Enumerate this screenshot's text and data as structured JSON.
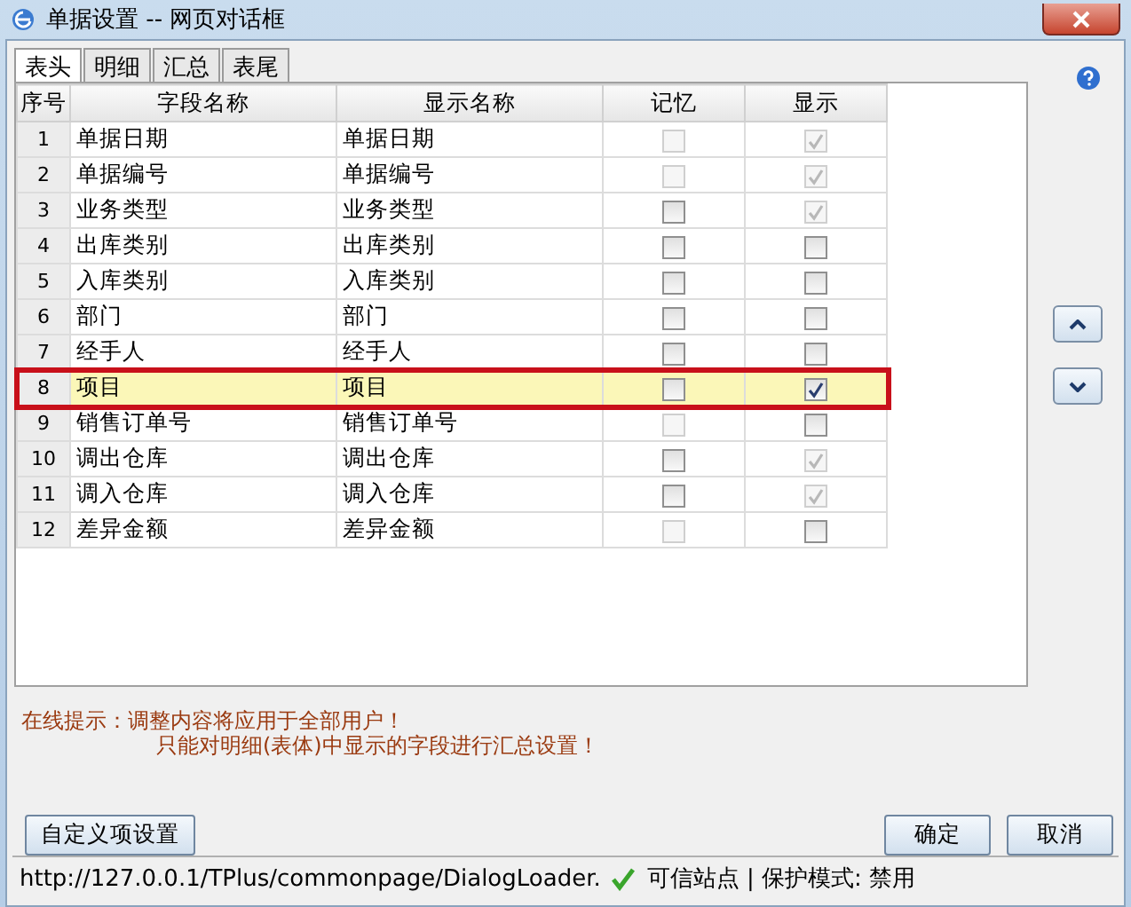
{
  "window": {
    "title": "单据设置 -- 网页对话框"
  },
  "tabs": [
    {
      "label": "表头",
      "selected": true
    },
    {
      "label": "明细",
      "selected": false
    },
    {
      "label": "汇总",
      "selected": false
    },
    {
      "label": "表尾",
      "selected": false
    }
  ],
  "table": {
    "columns": [
      "序号",
      "字段名称",
      "显示名称",
      "记忆",
      "显示"
    ],
    "rows": [
      {
        "no": "1",
        "field": "单据日期",
        "display": "单据日期",
        "selected": false,
        "outlined": false,
        "remember": {
          "checked": false,
          "disabled": true
        },
        "show": {
          "checked": true,
          "disabled": true
        }
      },
      {
        "no": "2",
        "field": "单据编号",
        "display": "单据编号",
        "selected": false,
        "outlined": false,
        "remember": {
          "checked": false,
          "disabled": true
        },
        "show": {
          "checked": true,
          "disabled": true
        }
      },
      {
        "no": "3",
        "field": "业务类型",
        "display": "业务类型",
        "selected": false,
        "outlined": false,
        "remember": {
          "checked": false,
          "disabled": false
        },
        "show": {
          "checked": true,
          "disabled": true
        }
      },
      {
        "no": "4",
        "field": "出库类别",
        "display": "出库类别",
        "selected": false,
        "outlined": false,
        "remember": {
          "checked": false,
          "disabled": false
        },
        "show": {
          "checked": false,
          "disabled": false
        }
      },
      {
        "no": "5",
        "field": "入库类别",
        "display": "入库类别",
        "selected": false,
        "outlined": false,
        "remember": {
          "checked": false,
          "disabled": false
        },
        "show": {
          "checked": false,
          "disabled": false
        }
      },
      {
        "no": "6",
        "field": "部门",
        "display": "部门",
        "selected": false,
        "outlined": false,
        "remember": {
          "checked": false,
          "disabled": false
        },
        "show": {
          "checked": false,
          "disabled": false
        }
      },
      {
        "no": "7",
        "field": "经手人",
        "display": "经手人",
        "selected": false,
        "outlined": false,
        "remember": {
          "checked": false,
          "disabled": false
        },
        "show": {
          "checked": false,
          "disabled": false
        }
      },
      {
        "no": "8",
        "field": "项目",
        "display": "项目",
        "selected": true,
        "outlined": true,
        "remember": {
          "checked": false,
          "disabled": false
        },
        "show": {
          "checked": true,
          "disabled": false
        }
      },
      {
        "no": "9",
        "field": "销售订单号",
        "display": "销售订单号",
        "selected": false,
        "outlined": false,
        "remember": {
          "checked": false,
          "disabled": true
        },
        "show": {
          "checked": false,
          "disabled": false
        }
      },
      {
        "no": "10",
        "field": "调出仓库",
        "display": "调出仓库",
        "selected": false,
        "outlined": false,
        "remember": {
          "checked": false,
          "disabled": false
        },
        "show": {
          "checked": true,
          "disabled": true
        }
      },
      {
        "no": "11",
        "field": "调入仓库",
        "display": "调入仓库",
        "selected": false,
        "outlined": false,
        "remember": {
          "checked": false,
          "disabled": false
        },
        "show": {
          "checked": true,
          "disabled": true
        }
      },
      {
        "no": "12",
        "field": "差异金额",
        "display": "差异金额",
        "selected": false,
        "outlined": false,
        "remember": {
          "checked": false,
          "disabled": true
        },
        "show": {
          "checked": false,
          "disabled": false
        }
      }
    ]
  },
  "tips": [
    "在线提示：调整内容将应用于全部用户！",
    "只能对明细(表体)中显示的字段进行汇总设置！"
  ],
  "buttons": {
    "custom": "自定义项设置",
    "ok": "确定",
    "cancel": "取消"
  },
  "status_bar": {
    "url": "http://127.0.0.1/TPlus/commonpage/DialogLoader.",
    "zone": "可信站点 | 保护模式: 禁用"
  }
}
